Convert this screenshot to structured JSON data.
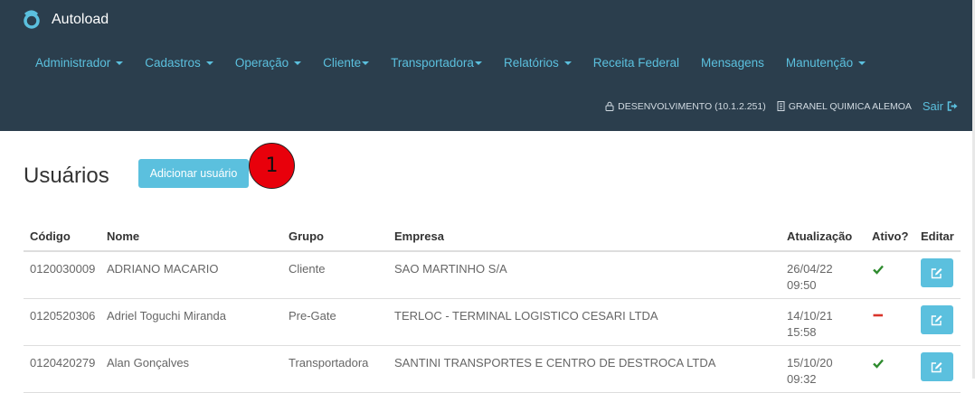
{
  "app": {
    "title": "Autoload"
  },
  "nav": {
    "items": [
      {
        "label": "Administrador",
        "dropdown": true
      },
      {
        "label": "Cadastros",
        "dropdown": true
      },
      {
        "label": "Operação",
        "dropdown": true
      },
      {
        "label": "Cliente",
        "dropdown": true
      },
      {
        "label": "Transportadora",
        "dropdown": true
      },
      {
        "label": "Relatórios",
        "dropdown": true
      },
      {
        "label": "Receita Federal",
        "dropdown": false
      },
      {
        "label": "Mensagens",
        "dropdown": false
      },
      {
        "label": "Manutenção",
        "dropdown": true
      }
    ]
  },
  "status": {
    "environment": "DESENVOLVIMENTO (10.1.2.251)",
    "company": "GRANEL QUIMICA ALEMOA",
    "logout_label": "Sair"
  },
  "page": {
    "title": "Usuários",
    "add_button_label": "Adicionar usuário",
    "marker_number": "1"
  },
  "table": {
    "headers": {
      "codigo": "Código",
      "nome": "Nome",
      "grupo": "Grupo",
      "empresa": "Empresa",
      "atualizacao": "Atualização",
      "ativo": "Ativo?",
      "editar": "Editar"
    },
    "rows": [
      {
        "codigo": "0120030009",
        "nome": "ADRIANO MACARIO",
        "grupo": "Cliente",
        "empresa": "SAO MARTINHO S/A",
        "data": "26/04/22",
        "hora": "09:50",
        "ativo": true
      },
      {
        "codigo": "0120520306",
        "nome": "Adriel Toguchi Miranda",
        "grupo": "Pre-Gate",
        "empresa": "TERLOC - TERMINAL LOGISTICO CESARI LTDA",
        "data": "14/10/21",
        "hora": "15:58",
        "ativo": false
      },
      {
        "codigo": "0120420279",
        "nome": "Alan Gonçalves",
        "grupo": "Transportadora",
        "empresa": "SANTINI TRANSPORTES E CENTRO DE DESTROCA LTDA",
        "data": "15/10/20",
        "hora": "09:32",
        "ativo": true
      }
    ]
  },
  "colors": {
    "topbar": "#2b3e4d",
    "accent": "#5bc0de",
    "active_check": "#2e8b2e",
    "inactive_dash": "#d9342b",
    "marker": "#e8000b"
  },
  "icons": {
    "brand": "autoload-logo-icon",
    "environment": "lock-icon",
    "company": "building-icon",
    "logout": "sign-out-icon",
    "active": "check-icon",
    "inactive": "minus-icon",
    "edit": "edit-icon"
  }
}
